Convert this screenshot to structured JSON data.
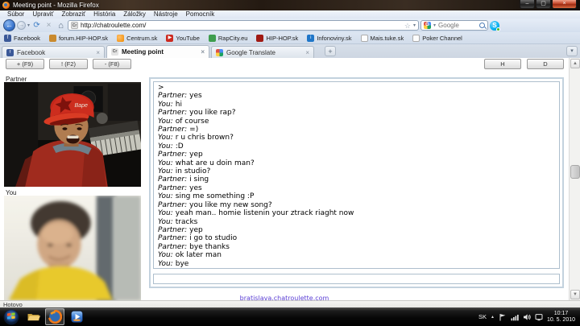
{
  "window": {
    "title": "Meeting point - Mozilla Firefox",
    "menu_items": [
      "Súbor",
      "Upraviť",
      "Zobraziť",
      "História",
      "Záložky",
      "Nástroje",
      "Pomocník"
    ],
    "minimize_glyph": "–",
    "maximize_glyph": "▢",
    "close_glyph": "×"
  },
  "navigation": {
    "url": "http://chatroulette.com/",
    "favicon_text": "Cr",
    "back_glyph": "←",
    "forward_glyph": "→",
    "reload_glyph": "⟳",
    "stop_glyph": "×",
    "home_glyph": "⌂",
    "bookmark_star_glyph": "☆",
    "search_placeholder": "Google",
    "search_engine": "Google",
    "skype_glyph": "S"
  },
  "bookmarks": [
    {
      "label": "Facebook",
      "icon_bg": "#3b5998",
      "icon_fg": "#fff",
      "glyph": "f"
    },
    {
      "label": "forum.HIP-HOP.sk",
      "icon_bg": "#c98a2e",
      "icon_fg": "#fff",
      "glyph": ""
    },
    {
      "label": "Centrum.sk",
      "icon_bg": "radial-gradient(circle at 35% 35%, #ffc06a, #f08a00)",
      "icon_fg": "#fff",
      "glyph": ""
    },
    {
      "label": "YouTube",
      "icon_bg": "#cc2a20",
      "icon_fg": "#fff",
      "glyph": "▶"
    },
    {
      "label": "RapCity.eu",
      "icon_bg": "#3f9d4e",
      "icon_fg": "#fff",
      "glyph": ""
    },
    {
      "label": "HIP-HOP.sk",
      "icon_bg": "#a01a14",
      "icon_fg": "#fff",
      "glyph": ""
    },
    {
      "label": "Infonoviny.sk",
      "icon_bg": "#1f76c8",
      "icon_fg": "#fff",
      "glyph": "i"
    },
    {
      "label": "Mais.tuke.sk",
      "page": true,
      "glyph": ""
    },
    {
      "label": "Poker Channel",
      "page": true,
      "glyph": ""
    }
  ],
  "tabs": [
    {
      "label": "Facebook",
      "icon_bg": "#3b5998",
      "icon_fg": "#fff",
      "glyph": "f",
      "active": false,
      "close_glyph": "×"
    },
    {
      "label": "Meeting point",
      "icon_bg": "#e3e3e3",
      "icon_fg": "#555",
      "glyph": "Cr",
      "active": true,
      "close_glyph": "×"
    },
    {
      "label": "Google Translate",
      "icon_bg": "conic-gradient(#4c8bf5 0 25%, #1aa260 0 50%, #ffce44 0 75%, #de5246 0)",
      "icon_fg": "#fff",
      "glyph": "",
      "active": false,
      "close_glyph": "×"
    }
  ],
  "tabstrip": {
    "new_tab_glyph": "+",
    "list_tabs_glyph": "▾"
  },
  "page": {
    "buttons_left": [
      "+ (F9)",
      "! (F2)",
      "- (F8)"
    ],
    "buttons_right": [
      "H",
      "D"
    ],
    "partner_label": "Partner",
    "you_label": "You",
    "chat": {
      "messages": [
        {
          "sender": "",
          "text": ">"
        },
        {
          "sender": "Partner:",
          "text": "yes"
        },
        {
          "sender": "You:",
          "text": "hi"
        },
        {
          "sender": "Partner:",
          "text": "you like rap?"
        },
        {
          "sender": "You:",
          "text": "of course"
        },
        {
          "sender": "Partner:",
          "text": "=)"
        },
        {
          "sender": "You:",
          "text": "r u chris brown?"
        },
        {
          "sender": "You:",
          "text": ":D"
        },
        {
          "sender": "Partner:",
          "text": "yep"
        },
        {
          "sender": "You:",
          "text": "what are u doin man?"
        },
        {
          "sender": "You:",
          "text": "in studio?"
        },
        {
          "sender": "Partner:",
          "text": "i sing"
        },
        {
          "sender": "Partner:",
          "text": "yes"
        },
        {
          "sender": "You:",
          "text": "sing me something :P"
        },
        {
          "sender": "Partner:",
          "text": "you like my new song?"
        },
        {
          "sender": "You:",
          "text": "yeah man.. homie listenin your ztrack riaght now"
        },
        {
          "sender": "You:",
          "text": "tracks"
        },
        {
          "sender": "Partner:",
          "text": "yep"
        },
        {
          "sender": "Partner:",
          "text": "i go to studio"
        },
        {
          "sender": "Partner:",
          "text": "bye thanks"
        },
        {
          "sender": "You:",
          "text": "ok later man"
        },
        {
          "sender": "You:",
          "text": "bye"
        }
      ],
      "input_value": ""
    },
    "footer_link": "bratislava.chatroulette.com"
  },
  "statusbar": {
    "text": "Hotovo"
  },
  "taskbar": {
    "tray": {
      "language": "SK",
      "hidden_icons_glyph": "▲",
      "time": "10:17",
      "date": "10. 5. 2010"
    }
  },
  "colors": {
    "accent_blue": "#3c77cf",
    "toolbar_bg": "#dfe7f3",
    "chat_border": "#aebfcd",
    "chat_panel_border": "#c3d2de",
    "visited_link": "#5b3fd4",
    "taskbar_bg": "#070707",
    "close_button_red": "#c4472a",
    "active_tab_bg": "#fdfdfd"
  }
}
